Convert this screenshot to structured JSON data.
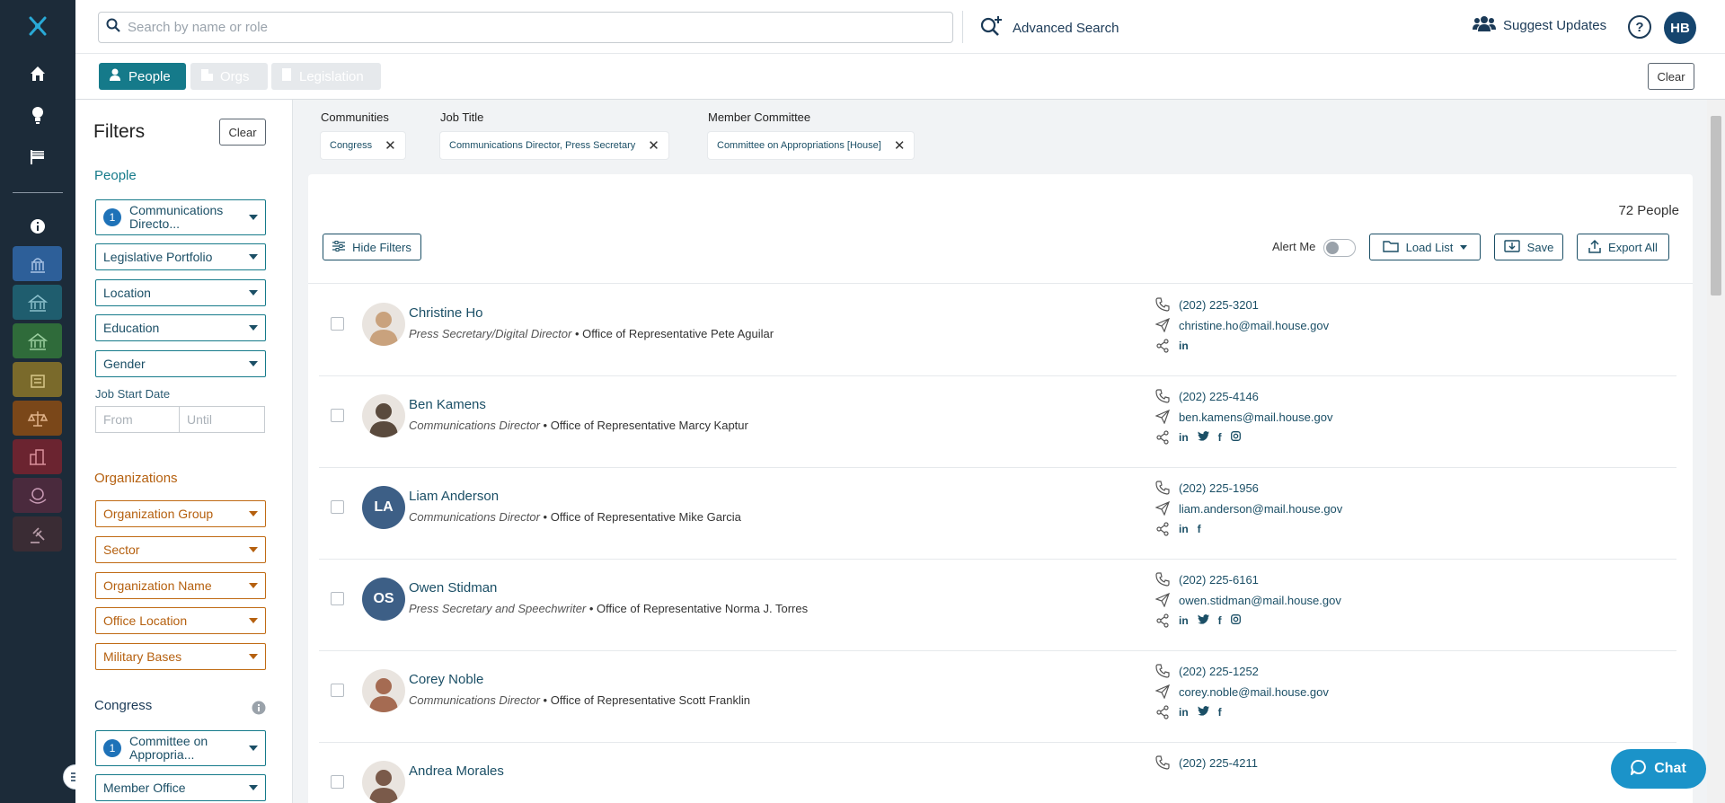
{
  "search": {
    "placeholder": "Search by name or role"
  },
  "header": {
    "advanced_search": "Advanced Search",
    "suggest_updates": "Suggest Updates",
    "help": "?",
    "avatar": "HB"
  },
  "tabs": [
    {
      "label": "People",
      "active": true
    },
    {
      "label": "Orgs",
      "active": false
    },
    {
      "label": "Legislation",
      "active": false
    }
  ],
  "clear_label": "Clear",
  "filters": {
    "title": "Filters",
    "clear": "Clear",
    "people_title": "People",
    "people": [
      "Communications Directo...",
      "Legislative Portfolio",
      "Location",
      "Education",
      "Gender"
    ],
    "people_badge": "1",
    "job_start_label": "Job Start Date",
    "from_placeholder": "From",
    "until_placeholder": "Until",
    "orgs_title": "Organizations",
    "orgs": [
      "Organization Group",
      "Sector",
      "Organization Name",
      "Office Location",
      "Military Bases"
    ],
    "congress_title": "Congress",
    "congress": [
      "Committee on Appropria...",
      "Member Office"
    ],
    "congress_badge": "1"
  },
  "chips": [
    {
      "label": "Communities",
      "value": "Congress"
    },
    {
      "label": "Job Title",
      "value": "Communications Director, Press Secretary"
    },
    {
      "label": "Member Committee",
      "value": "Committee on Appropriations [House]"
    }
  ],
  "results": {
    "count": "72 People",
    "hide_filters": "Hide Filters",
    "alert_me": "Alert Me",
    "alert_on": false,
    "load_list": "Load List",
    "save": "Save",
    "export_all": "Export All"
  },
  "people": [
    {
      "name": "Christine Ho",
      "title": "Press Secretary/Digital Director",
      "office": "Office of Representative Pete Aguilar",
      "phone": "(202) 225-3201",
      "email": "christine.ho@mail.house.gov",
      "social": [
        "in"
      ],
      "initials": "",
      "photo": true
    },
    {
      "name": "Ben Kamens",
      "title": "Communications Director",
      "office": "Office of Representative Marcy Kaptur",
      "phone": "(202) 225-4146",
      "email": "ben.kamens@mail.house.gov",
      "social": [
        "in",
        "tw",
        "f",
        "ig"
      ],
      "initials": "",
      "photo": true
    },
    {
      "name": "Liam Anderson",
      "title": "Communications Director",
      "office": "Office of Representative Mike Garcia",
      "phone": "(202) 225-1956",
      "email": "liam.anderson@mail.house.gov",
      "social": [
        "in",
        "f"
      ],
      "initials": "LA",
      "photo": false
    },
    {
      "name": "Owen Stidman",
      "title": "Press Secretary and Speechwriter",
      "office": "Office of Representative Norma J. Torres",
      "phone": "(202) 225-6161",
      "email": "owen.stidman@mail.house.gov",
      "social": [
        "in",
        "tw",
        "f",
        "ig"
      ],
      "initials": "OS",
      "photo": false
    },
    {
      "name": "Corey Noble",
      "title": "Communications Director",
      "office": "Office of Representative Scott Franklin",
      "phone": "(202) 225-1252",
      "email": "corey.noble@mail.house.gov",
      "social": [
        "in",
        "tw",
        "f"
      ],
      "initials": "",
      "photo": true
    },
    {
      "name": "Andrea Morales",
      "title": "",
      "office": "",
      "phone": "(202) 225-4211",
      "email": "",
      "social": [],
      "initials": "",
      "photo": true
    }
  ],
  "chat": "Chat",
  "colors": {
    "rail": "#1c2b39",
    "teal": "#157a8a",
    "navy": "#1b4f66",
    "orange": "#c06b14",
    "avatar_blue": "#3d5f86",
    "chat": "#1b93c9"
  }
}
